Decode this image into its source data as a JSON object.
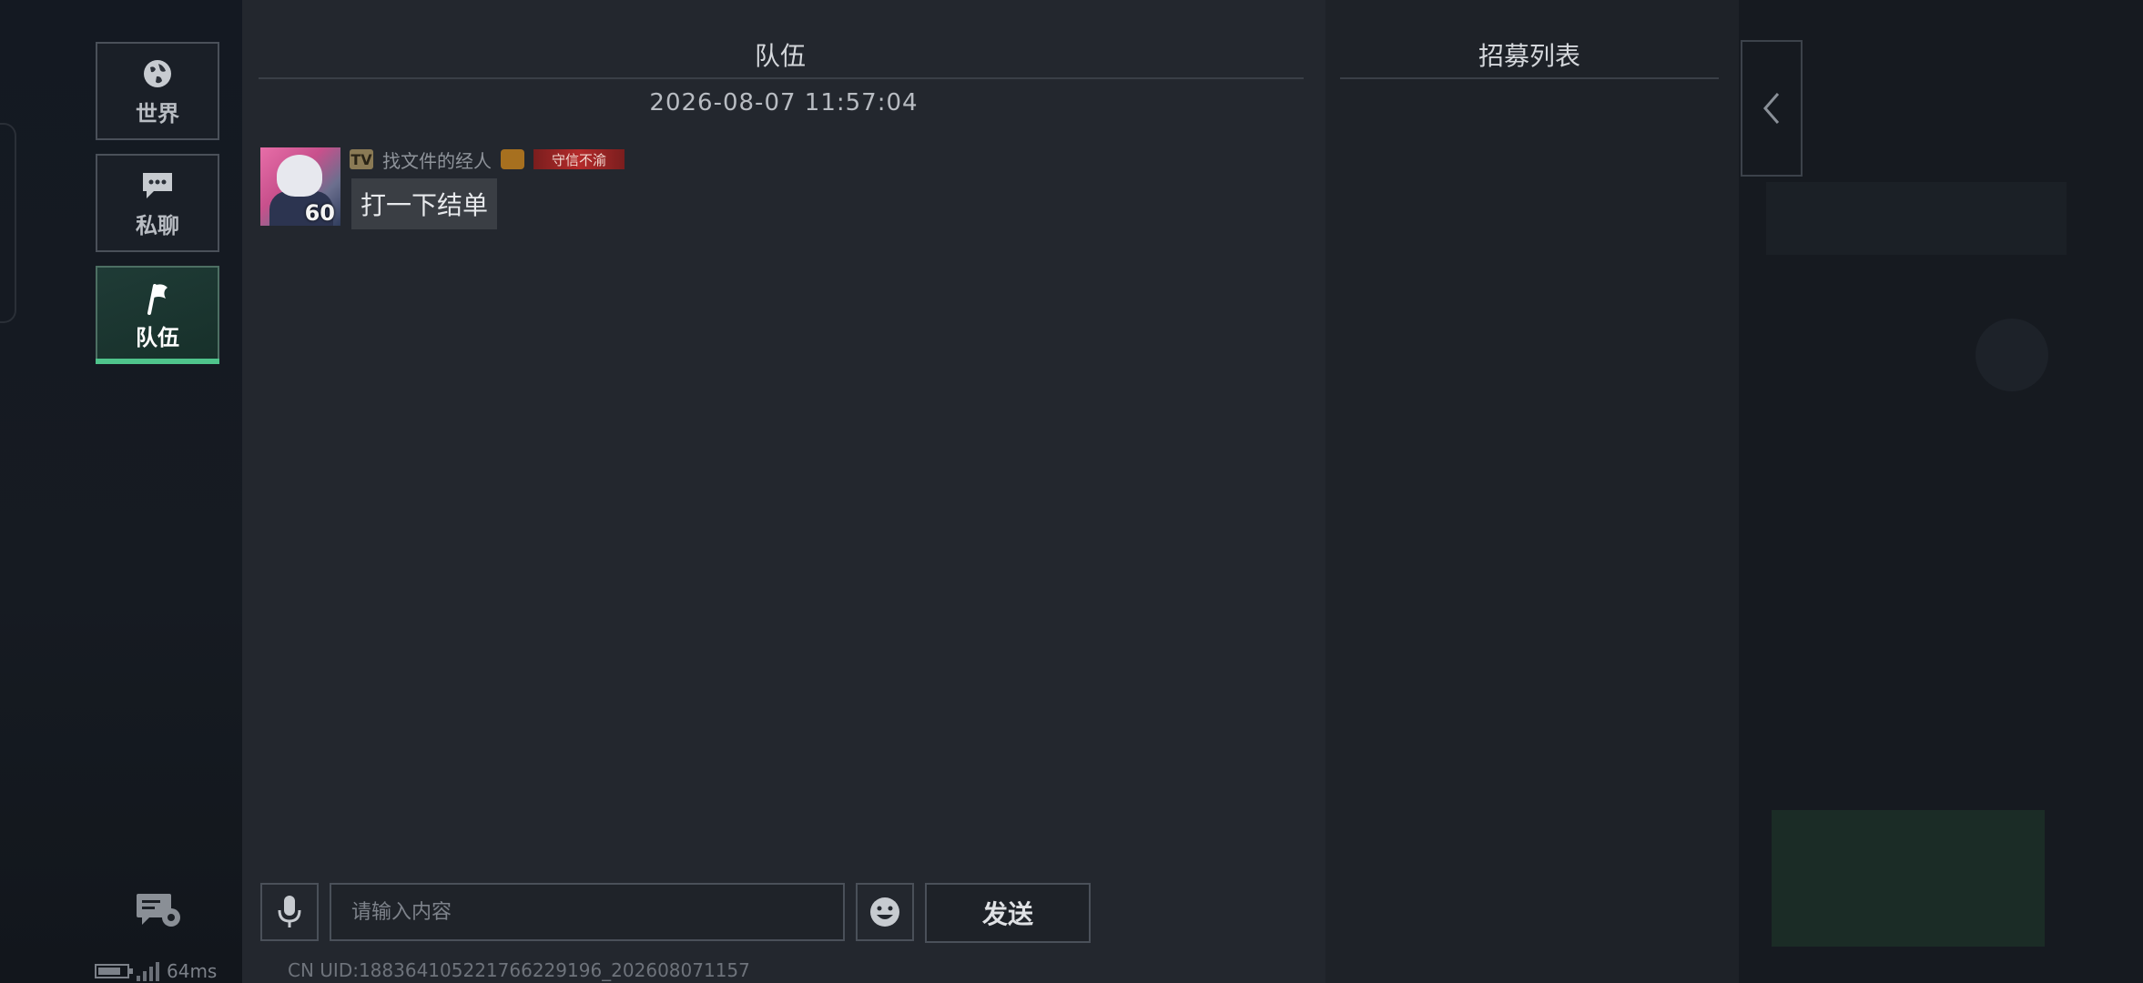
{
  "sidebar": {
    "tabs": [
      {
        "label": "世界",
        "icon": "globe-icon"
      },
      {
        "label": "私聊",
        "icon": "chat-bubble-icon"
      },
      {
        "label": "队伍",
        "icon": "flag-icon",
        "active": true
      }
    ],
    "settings_icon": "chat-settings-icon",
    "status": {
      "ping": "64ms"
    }
  },
  "chat": {
    "title": "队伍",
    "timestamp": "2026-08-07 11:57:04",
    "messages": [
      {
        "level": "60",
        "badge": "TV",
        "name": "找文件的经人",
        "honor": "守信不渝",
        "text": "打一下结单"
      }
    ],
    "input_placeholder": "请输入内容",
    "send_label": "发送",
    "uid": "CN UID:188364105221766229196_202608071157"
  },
  "recruit": {
    "title": "招募列表"
  },
  "colors": {
    "accent": "#4fc48c",
    "honor_tag": "#b42a2a"
  }
}
